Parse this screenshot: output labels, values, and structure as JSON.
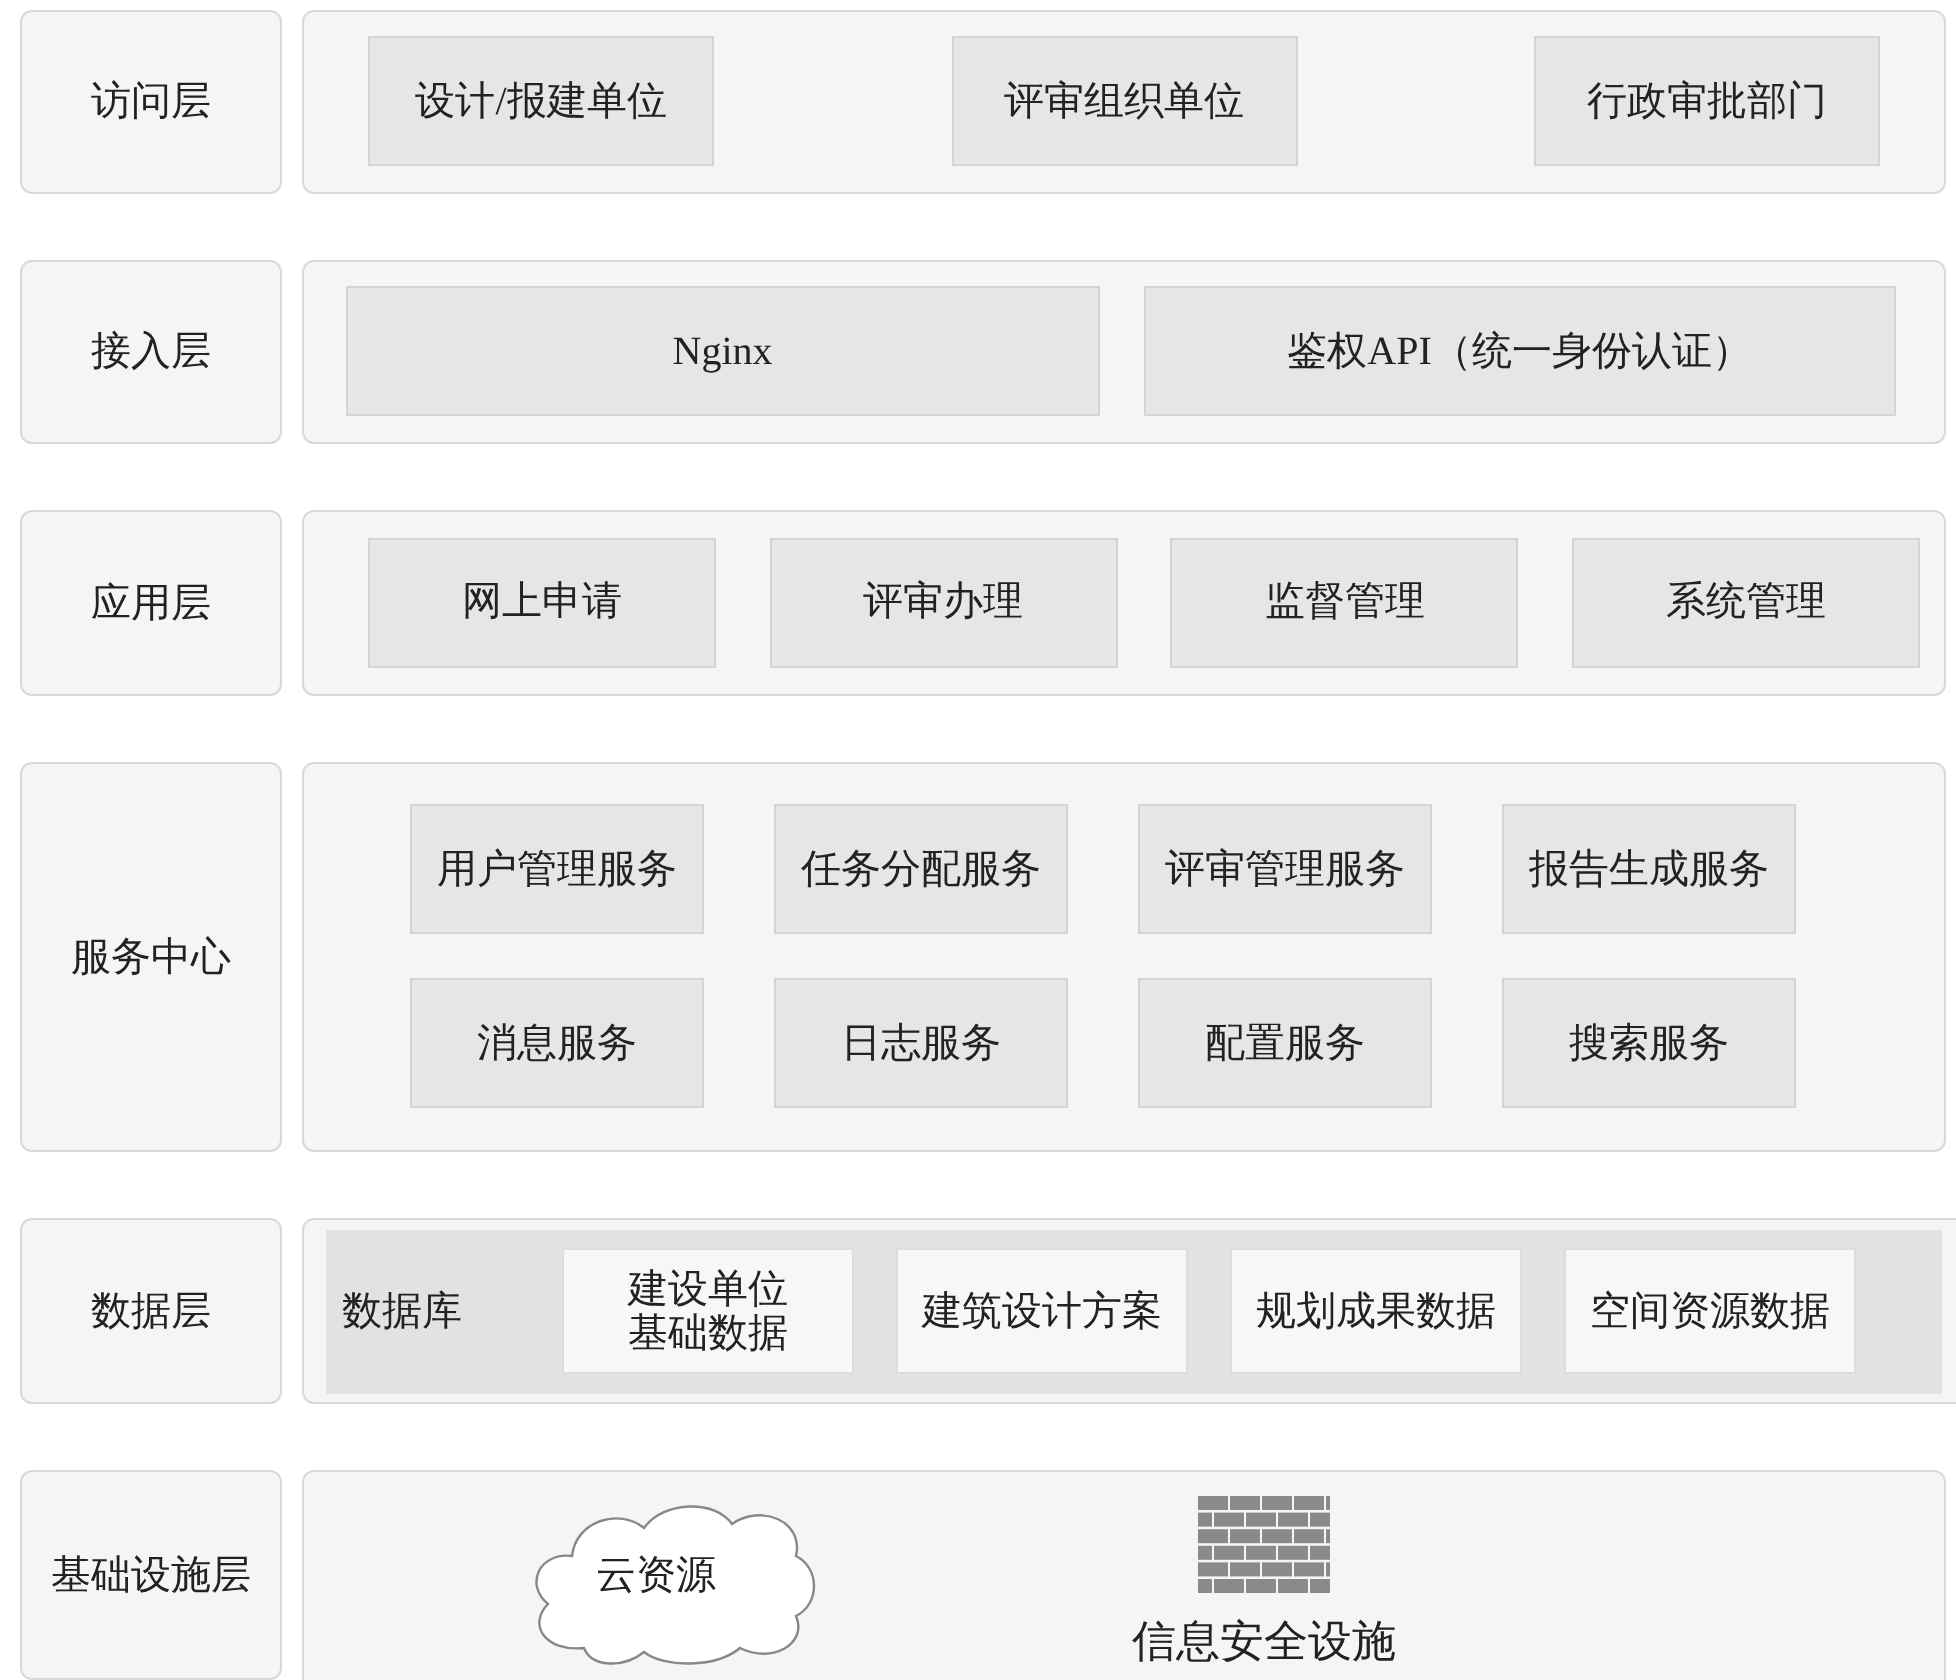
{
  "layers": [
    {
      "label": "访问层",
      "kind": "spread",
      "items": [
        "设计/报建单位",
        "评审组织单位",
        "行政审批部门"
      ]
    },
    {
      "label": "接入层",
      "kind": "fill",
      "items": [
        "Nginx",
        "鉴权API（统一身份认证）"
      ]
    },
    {
      "label": "应用层",
      "kind": "spread4",
      "items": [
        "网上申请",
        "评审办理",
        "监督管理",
        "系统管理"
      ]
    },
    {
      "label": "服务中心",
      "kind": "grid",
      "items": [
        "用户管理服务",
        "任务分配服务",
        "评审管理服务",
        "报告生成服务",
        "消息服务",
        "日志服务",
        "配置服务",
        "搜索服务"
      ]
    },
    {
      "label": "数据层",
      "kind": "database",
      "title": "数据库",
      "items": [
        "建设单位基础数据",
        "建筑设计方案",
        "规划成果数据",
        "空间资源数据"
      ]
    },
    {
      "label": "基础设施层",
      "kind": "infra",
      "items": [
        {
          "kind": "cloud",
          "label": "云资源"
        },
        {
          "kind": "firewall",
          "label": "信息安全设施"
        }
      ]
    }
  ]
}
